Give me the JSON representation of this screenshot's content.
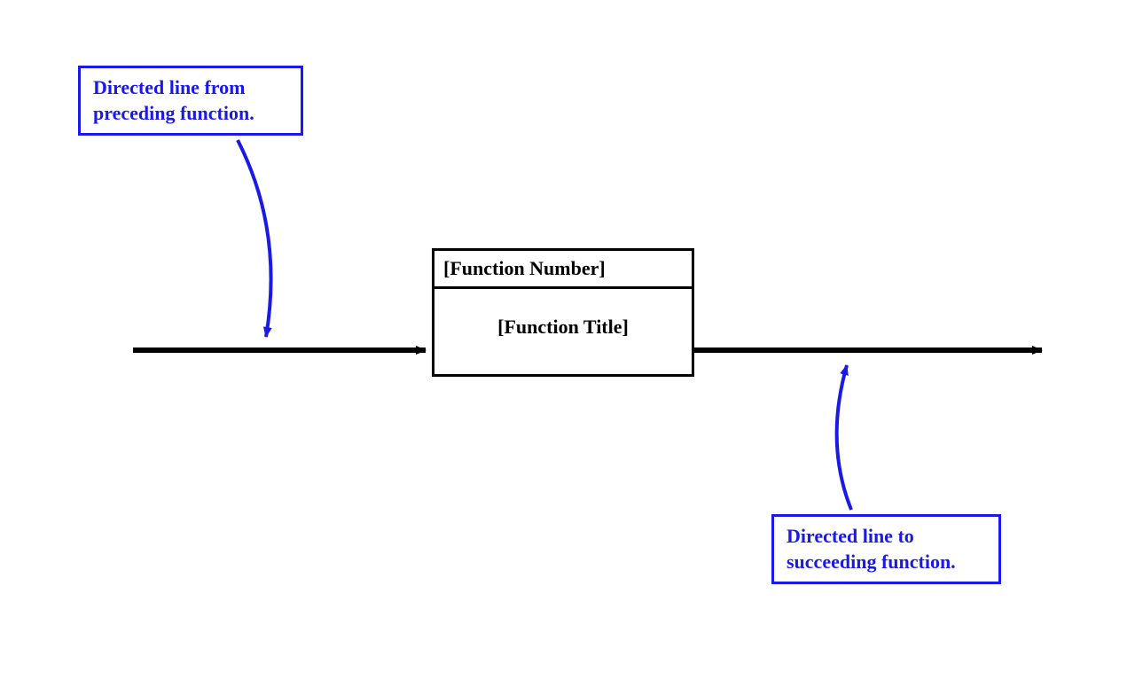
{
  "callouts": {
    "preceding": {
      "line1": "Directed line from",
      "line2": "preceding function."
    },
    "succeeding": {
      "line1": "Directed line to",
      "line2": "succeeding function."
    }
  },
  "function_box": {
    "number": "[Function Number]",
    "title": "[Function Title]"
  },
  "colors": {
    "callout_border": "#1a1ae6",
    "callout_text": "#1a1ae6",
    "box_border": "#000000",
    "arrow": "#000000"
  }
}
